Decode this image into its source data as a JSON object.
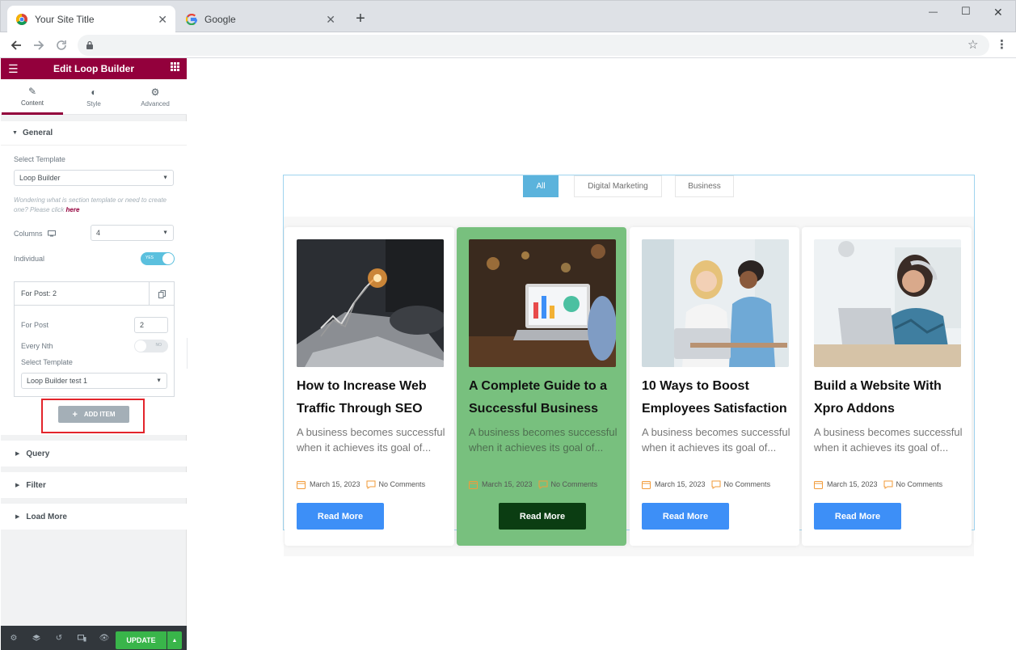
{
  "browser": {
    "tabs": [
      {
        "title": "Your Site Title",
        "close": "✕"
      },
      {
        "title": "Google",
        "close": "✕"
      }
    ],
    "new_tab": "+",
    "window_controls": {
      "minimize": "—",
      "maximize": "☐",
      "close": "✕"
    }
  },
  "panel": {
    "title": "Edit Loop Builder",
    "tabs": [
      {
        "label": "Content",
        "icon": "pencil-icon"
      },
      {
        "label": "Style",
        "icon": "contrast-icon"
      },
      {
        "label": "Advanced",
        "icon": "gear-icon"
      }
    ],
    "general": {
      "label": "General",
      "select_template_label": "Select Template",
      "select_template_value": "Loop Builder",
      "help_text": "Wondering what is section template or need to create one? Please click",
      "help_link": "here",
      "columns_label": "Columns",
      "columns_value": "4",
      "individual_label": "Individual",
      "individual_toggle": "YES",
      "repeater": {
        "header": "For Post: 2",
        "for_post_label": "For Post",
        "for_post_value": "2",
        "every_nth_label": "Every Nth",
        "every_nth_toggle": "NO",
        "select_template_label": "Select Template",
        "select_template_value": "Loop Builder test 1"
      },
      "add_item": "ADD ITEM",
      "add_item_plus": "+"
    },
    "sections": [
      "Query",
      "Filter",
      "Load More"
    ],
    "update": "UPDATE"
  },
  "filters": [
    "All",
    "Digital Marketing",
    "Business"
  ],
  "posts": [
    {
      "title": "How to Increase Web Traffic Through SEO",
      "excerpt": "A business becomes successful when it achieves its goal of...",
      "date": "March 15, 2023",
      "comments": "No Comments",
      "button": "Read More"
    },
    {
      "title": "A Complete Guide to a Successful Business",
      "excerpt": "A business becomes successful when it achieves its goal of...",
      "date": "March 15, 2023",
      "comments": "No Comments",
      "button": "Read More"
    },
    {
      "title": "10 Ways to Boost Employees Satisfaction",
      "excerpt": "A business becomes successful when it achieves its goal of...",
      "date": "March 15, 2023",
      "comments": "No Comments",
      "button": "Read More"
    },
    {
      "title": "Build a Website With Xpro Addons",
      "excerpt": "A business becomes successful when it achieves its goal of...",
      "date": "March 15, 2023",
      "comments": "No Comments",
      "button": "Read More"
    }
  ],
  "colors": {
    "panel_header": "#93003c",
    "toggle_on": "#5bc0de",
    "filter_active": "#5bb3dc",
    "read_more": "#3d8ff7",
    "highlight_card": "#78c07e",
    "highlight_button": "#0b3d12",
    "update_button": "#39b54a",
    "annotation_box": "#e3242b"
  }
}
